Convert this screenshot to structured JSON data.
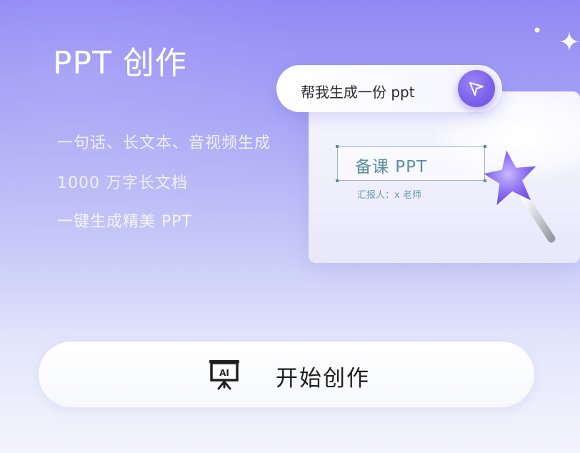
{
  "header": {
    "title": "PPT 创作"
  },
  "features": [
    "一句话、长文本、音视频生成",
    "1000 万字长文档",
    "一键生成精美 PPT"
  ],
  "illustration": {
    "prompt_text": "帮我生成一份 ppt",
    "send_icon": "send-icon",
    "slide_title": "备课 PPT",
    "slide_subtitle": "汇报人：x 老师",
    "wand_icon": "magic-wand-icon"
  },
  "action": {
    "label": "开始创作",
    "icon": "ai-presentation-icon"
  },
  "colors": {
    "background_top": "#9189f5",
    "background_bottom": "#f3f4fd",
    "accent": "#7a60ea",
    "slide_text": "#5a8ea0"
  }
}
